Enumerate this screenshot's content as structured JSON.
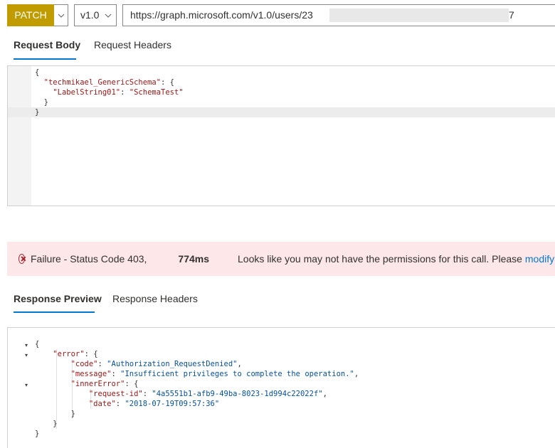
{
  "toolbar": {
    "method": "PATCH",
    "version": "v1.0",
    "url_prefix": "https://graph.microsoft.com/v1.0/users/23",
    "url_suffix": "7"
  },
  "request_tabs": [
    {
      "label": "Request Body",
      "active": true
    },
    {
      "label": "Request Headers",
      "active": false
    }
  ],
  "request_body": {
    "line1": "{",
    "line2_key": "\"techmikael_GenericSchema\"",
    "line2_rest": ": {",
    "line3_key": "\"LabelString01\"",
    "line3_sep": ": ",
    "line3_val": "\"SchemaTest\"",
    "line4": "}",
    "line5": "}"
  },
  "status": {
    "failure": "Failure - Status Code 403,",
    "duration": "774ms",
    "message": "Looks like you may not have the permissions for this call. Please",
    "link": "modify y"
  },
  "response_tabs": [
    {
      "label": "Response Preview",
      "active": true
    },
    {
      "label": "Response Headers",
      "active": false
    }
  ],
  "response": {
    "open": "{",
    "error_key": "\"error\"",
    "code_key": "\"code\"",
    "code_val": "\"Authorization_RequestDenied\"",
    "message_key": "\"message\"",
    "message_val": "\"Insufficient privileges to complete the operation.\"",
    "inner_key": "\"innerError\"",
    "reqid_key": "\"request-id\"",
    "reqid_val": "\"4a5551b1-afb9-49ba-8023-1d994c22022f\"",
    "date_key": "\"date\"",
    "date_val": "\"2018-07-19T09:57:36\"",
    "close_inner": "}",
    "close_error": "}",
    "close": "}"
  },
  "colors": {
    "method": "#c19c00",
    "accent": "#0078d4",
    "error_bg": "#fde7e9",
    "error_icon": "#a4262c"
  }
}
